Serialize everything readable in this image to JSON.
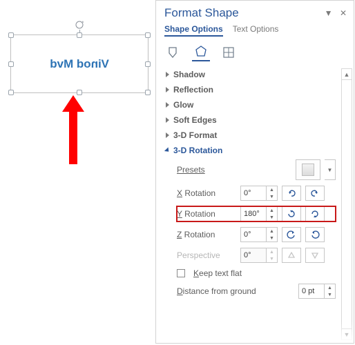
{
  "canvas": {
    "shape_text": "Vinod Mvd"
  },
  "pane": {
    "title": "Format Shape",
    "tab_shape": "Shape Options",
    "tab_text": "Text Options"
  },
  "sections": {
    "shadow": "Shadow",
    "reflection": "Reflection",
    "glow": "Glow",
    "soft_edges": "Soft Edges",
    "format3d": "3-D Format",
    "rotation3d": "3-D Rotation"
  },
  "rotation": {
    "presets_label": "Presets",
    "x_label_u": "X",
    "x_label": " Rotation",
    "x_value": "0°",
    "y_label_u": "Y",
    "y_label": " Rotation",
    "y_value": "180°",
    "z_label_u": "Z",
    "z_label": " Rotation",
    "z_value": "0°",
    "persp_label_u": "P",
    "persp_label": "erspective",
    "persp_value": "0°",
    "keep_flat_u": "K",
    "keep_flat": "eep text flat",
    "dist_label_u": "D",
    "dist_label": "istance from ground",
    "dist_value": "0 pt"
  }
}
